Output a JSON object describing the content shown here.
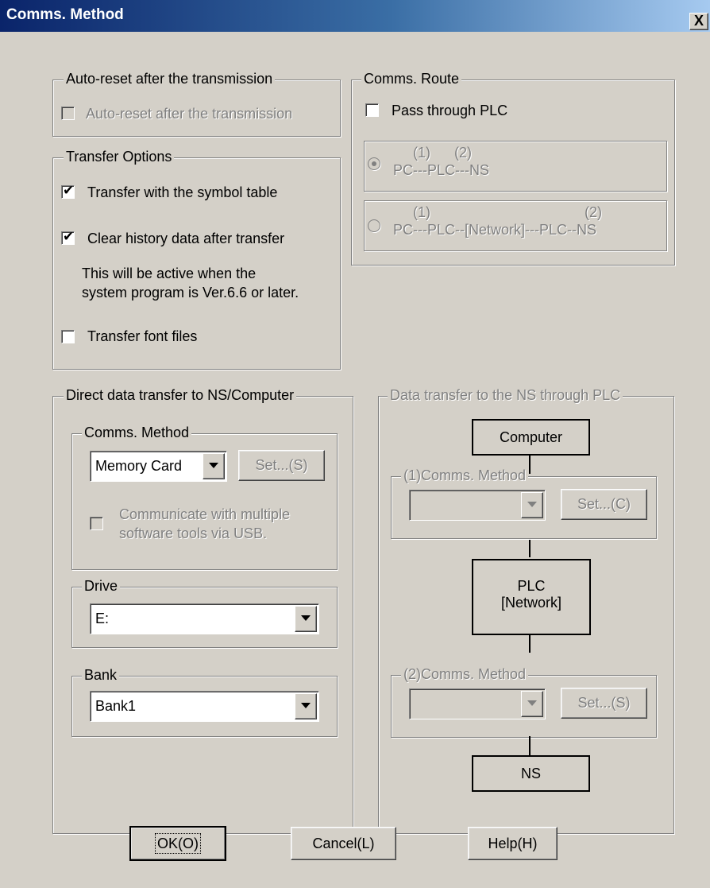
{
  "window": {
    "title": "Comms. Method",
    "close_label": "X"
  },
  "auto_reset": {
    "group_label": "Auto-reset after the transmission",
    "checkbox_label": "Auto-reset after the transmission",
    "checked": false
  },
  "transfer_options": {
    "group_label": "Transfer Options",
    "symbol_table_label": "Transfer with the symbol table",
    "clear_history_label": "Clear history data after transfer",
    "note_line1": "This will be active when the",
    "note_line2": "system program is Ver.6.6 or later.",
    "font_files_label": "Transfer font files"
  },
  "comms_route": {
    "group_label": "Comms. Route",
    "pass_through_label": "Pass through PLC",
    "option1_marks": "(1)      (2)",
    "option1_path": "PC---PLC---NS",
    "option2_mark1": "(1)",
    "option2_mark2": "(2)",
    "option2_path": "PC---PLC--[Network]---PLC--NS"
  },
  "direct_transfer": {
    "group_label": "Direct data transfer to NS/Computer",
    "comms_method_label": "Comms. Method",
    "comms_method_value": "Memory Card",
    "set_button": "Set...(S)",
    "usb_line1": "Communicate with multiple",
    "usb_line2": "software tools via USB.",
    "drive_label": "Drive",
    "drive_value": "E:",
    "bank_label": "Bank",
    "bank_value": "Bank1"
  },
  "plc_transfer": {
    "group_label": "Data transfer to the NS through PLC",
    "computer_label": "Computer",
    "method1_label": "(1)Comms. Method",
    "set1_button": "Set...(C)",
    "plc_line1": "PLC",
    "plc_line2": "[Network]",
    "method2_label": "(2)Comms. Method",
    "set2_button": "Set...(S)",
    "ns_label": "NS"
  },
  "footer": {
    "ok": "OK(O)",
    "cancel": "Cancel(L)",
    "help": "Help(H)"
  }
}
